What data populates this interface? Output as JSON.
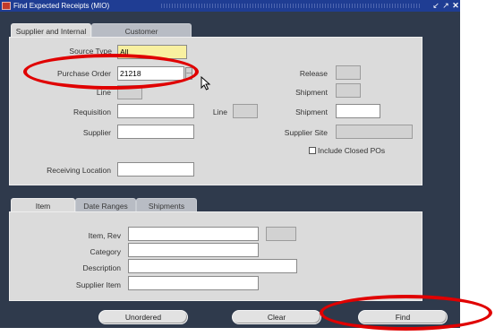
{
  "window": {
    "title": "Find Expected Receipts (MIO)",
    "controls": [
      "minimize",
      "maximize",
      "close"
    ]
  },
  "top_tabs": [
    {
      "label": "Supplier and Internal",
      "active": true
    },
    {
      "label": "Customer",
      "active": false
    }
  ],
  "source_type": {
    "label": "Source Type",
    "value": "All"
  },
  "purchase_order": {
    "label": "Purchase Order",
    "value": "21218"
  },
  "release": {
    "label": "Release",
    "value": ""
  },
  "line_top": {
    "label": "Line",
    "value": ""
  },
  "shipment_top": {
    "label": "Shipment",
    "value": ""
  },
  "requisition": {
    "label": "Requisition",
    "value": ""
  },
  "line": {
    "label": "Line",
    "value": ""
  },
  "shipment": {
    "label": "Shipment",
    "value": ""
  },
  "supplier": {
    "label": "Supplier",
    "value": ""
  },
  "supplier_site": {
    "label": "Supplier Site",
    "value": ""
  },
  "include_closed": {
    "label": "Include Closed POs",
    "checked": false
  },
  "receiving_location": {
    "label": "Receiving Location",
    "value": ""
  },
  "bottom_tabs": [
    {
      "label": "Item",
      "active": true
    },
    {
      "label": "Date Ranges",
      "active": false
    },
    {
      "label": "Shipments",
      "active": false
    }
  ],
  "item_rev": {
    "label": "Item, Rev",
    "value": "",
    "rev": ""
  },
  "category": {
    "label": "Category",
    "value": ""
  },
  "description": {
    "label": "Description",
    "value": ""
  },
  "supplier_item": {
    "label": "Supplier Item",
    "value": ""
  },
  "buttons": {
    "unordered": "Unordered",
    "clear": "Clear",
    "find": "Find"
  },
  "colors": {
    "window_bg": "#2f3a4c",
    "title_bar": "#1f3d93",
    "panel": "#dbdbdb",
    "highlight": "#e00000"
  }
}
